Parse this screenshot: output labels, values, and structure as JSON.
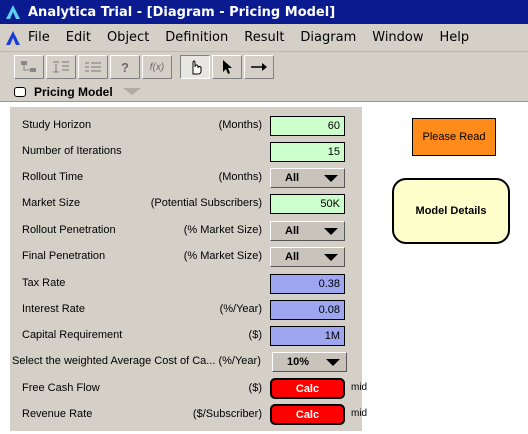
{
  "window": {
    "title": "Analytica Trial - [Diagram - Pricing Model]"
  },
  "menu": [
    "File",
    "Edit",
    "Object",
    "Definition",
    "Result",
    "Diagram",
    "Window",
    "Help"
  ],
  "tab": {
    "label": "Pricing Model"
  },
  "colors": {
    "input_green": "#ccffcc",
    "input_blue": "#9ea6f0",
    "calc_red": "#ff0000",
    "note_orange": "#ff8c1a",
    "module_yellow": "#ffffcc",
    "titlebar": "#0a1a8f"
  },
  "rows": [
    {
      "label": "Study Horizon",
      "unit": "(Months)",
      "value": "60"
    },
    {
      "label": "Number of Iterations",
      "unit": "",
      "value": "15"
    },
    {
      "label": "Rollout Time",
      "unit": "(Months)",
      "value": "All"
    },
    {
      "label": "Market Size",
      "unit": "(Potential Subscribers)",
      "value": "50K"
    },
    {
      "label": "Rollout Penetration",
      "unit": "(% Market Size)",
      "value": "All"
    },
    {
      "label": "Final Penetration",
      "unit": "(% Market Size)",
      "value": "All"
    },
    {
      "label": "Tax Rate",
      "unit": "",
      "value": "0.38"
    },
    {
      "label": "Interest Rate",
      "unit": "(%/Year)",
      "value": "0.08"
    },
    {
      "label": "Capital Requirement",
      "unit": "($)",
      "value": "1M"
    },
    {
      "label": "Free Cash Flow",
      "unit": "($)",
      "value": "Calc",
      "note": "mid"
    },
    {
      "label": "Revenue Rate",
      "unit": "($/Subscriber)",
      "value": "Calc",
      "note": "mid"
    }
  ],
  "wacc": {
    "label": "Select the weighted Average Cost of Ca... (%/Year)",
    "value": "10%"
  },
  "please_read": "Please Read",
  "model_details": "Model Details"
}
